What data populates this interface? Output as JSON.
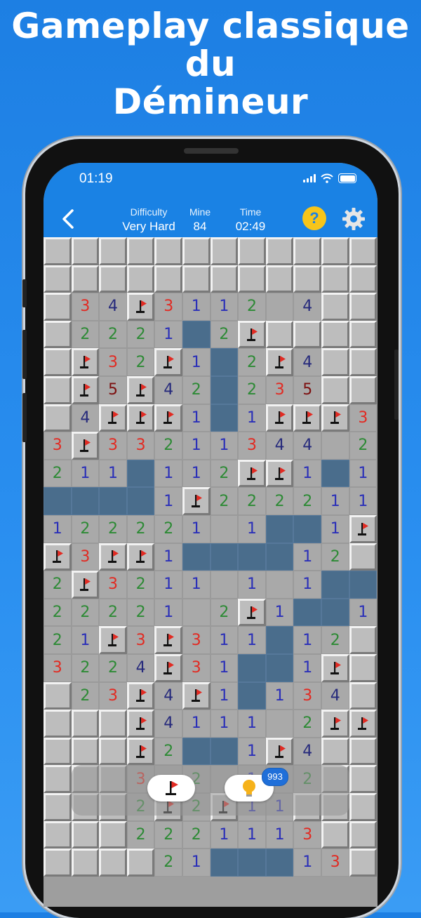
{
  "headline": {
    "line1": "Gameplay classique",
    "line2": "du",
    "line3": "Démineur"
  },
  "status_bar": {
    "time": "01:19",
    "icons": [
      "signal-icon",
      "wifi-icon",
      "battery-icon"
    ]
  },
  "header": {
    "back_icon": "chevron-left-icon",
    "difficulty": {
      "label": "Difficulty",
      "value": "Very Hard"
    },
    "mine": {
      "label": "Mine",
      "value": "84"
    },
    "time": {
      "label": "Time",
      "value": "02:49"
    },
    "help_label": "?",
    "settings_icon": "gear-icon"
  },
  "colors": {
    "background": "#1d7fe3",
    "topbar": "#1a82e4",
    "unrevealed": "#bdbdbd",
    "revealed": "#a9a9a9",
    "empty_revealed": "#4a6d8c",
    "help_button": "#f7c51a",
    "flag": "#e22a22",
    "num1": "#2a2fb8",
    "num2": "#2d8a35",
    "num3": "#e22a22",
    "num4": "#262a7c",
    "num5": "#7d1010"
  },
  "board": {
    "legend": {
      "U": "unrevealed",
      "F": "flag",
      "E": "revealed-empty",
      "1": "number-1",
      "2": "number-2",
      "3": "number-3",
      "4": "number-4",
      "5": "number-5",
      "R": "revealed-under-overlay"
    },
    "rows": [
      "UUUUUUUUUUUU",
      "UUUUUUUUUUUU",
      "U34F3112 4UUU",
      "U2221E2FUUUU",
      "UF32F1E2F4UU",
      "UF5F42E235UU",
      "U4FFF1E1FFF3",
      "3F33211344 22",
      "211E112FF1E1",
      "EEEE1F222211",
      "122221 1EE1F2",
      "F3FF1EEEE12U",
      "2F3211 1 1EE2U",
      "22221 2F1EE1U",
      "21F3F311E12U",
      "3224F31EE1FU",
      "U23F4F1E134U",
      "UUUF4111 2FFU",
      "UUUF2EE1F4UU",
      "UUU3 2 1 2UUU",
      "UUU2F2F11UUU",
      "UUU2221113UU",
      "UUUU21EEE13U"
    ]
  },
  "bottom_controls": {
    "flag_icon": "flag-icon",
    "hint_icon": "lightbulb-icon",
    "hint_count": "993"
  }
}
